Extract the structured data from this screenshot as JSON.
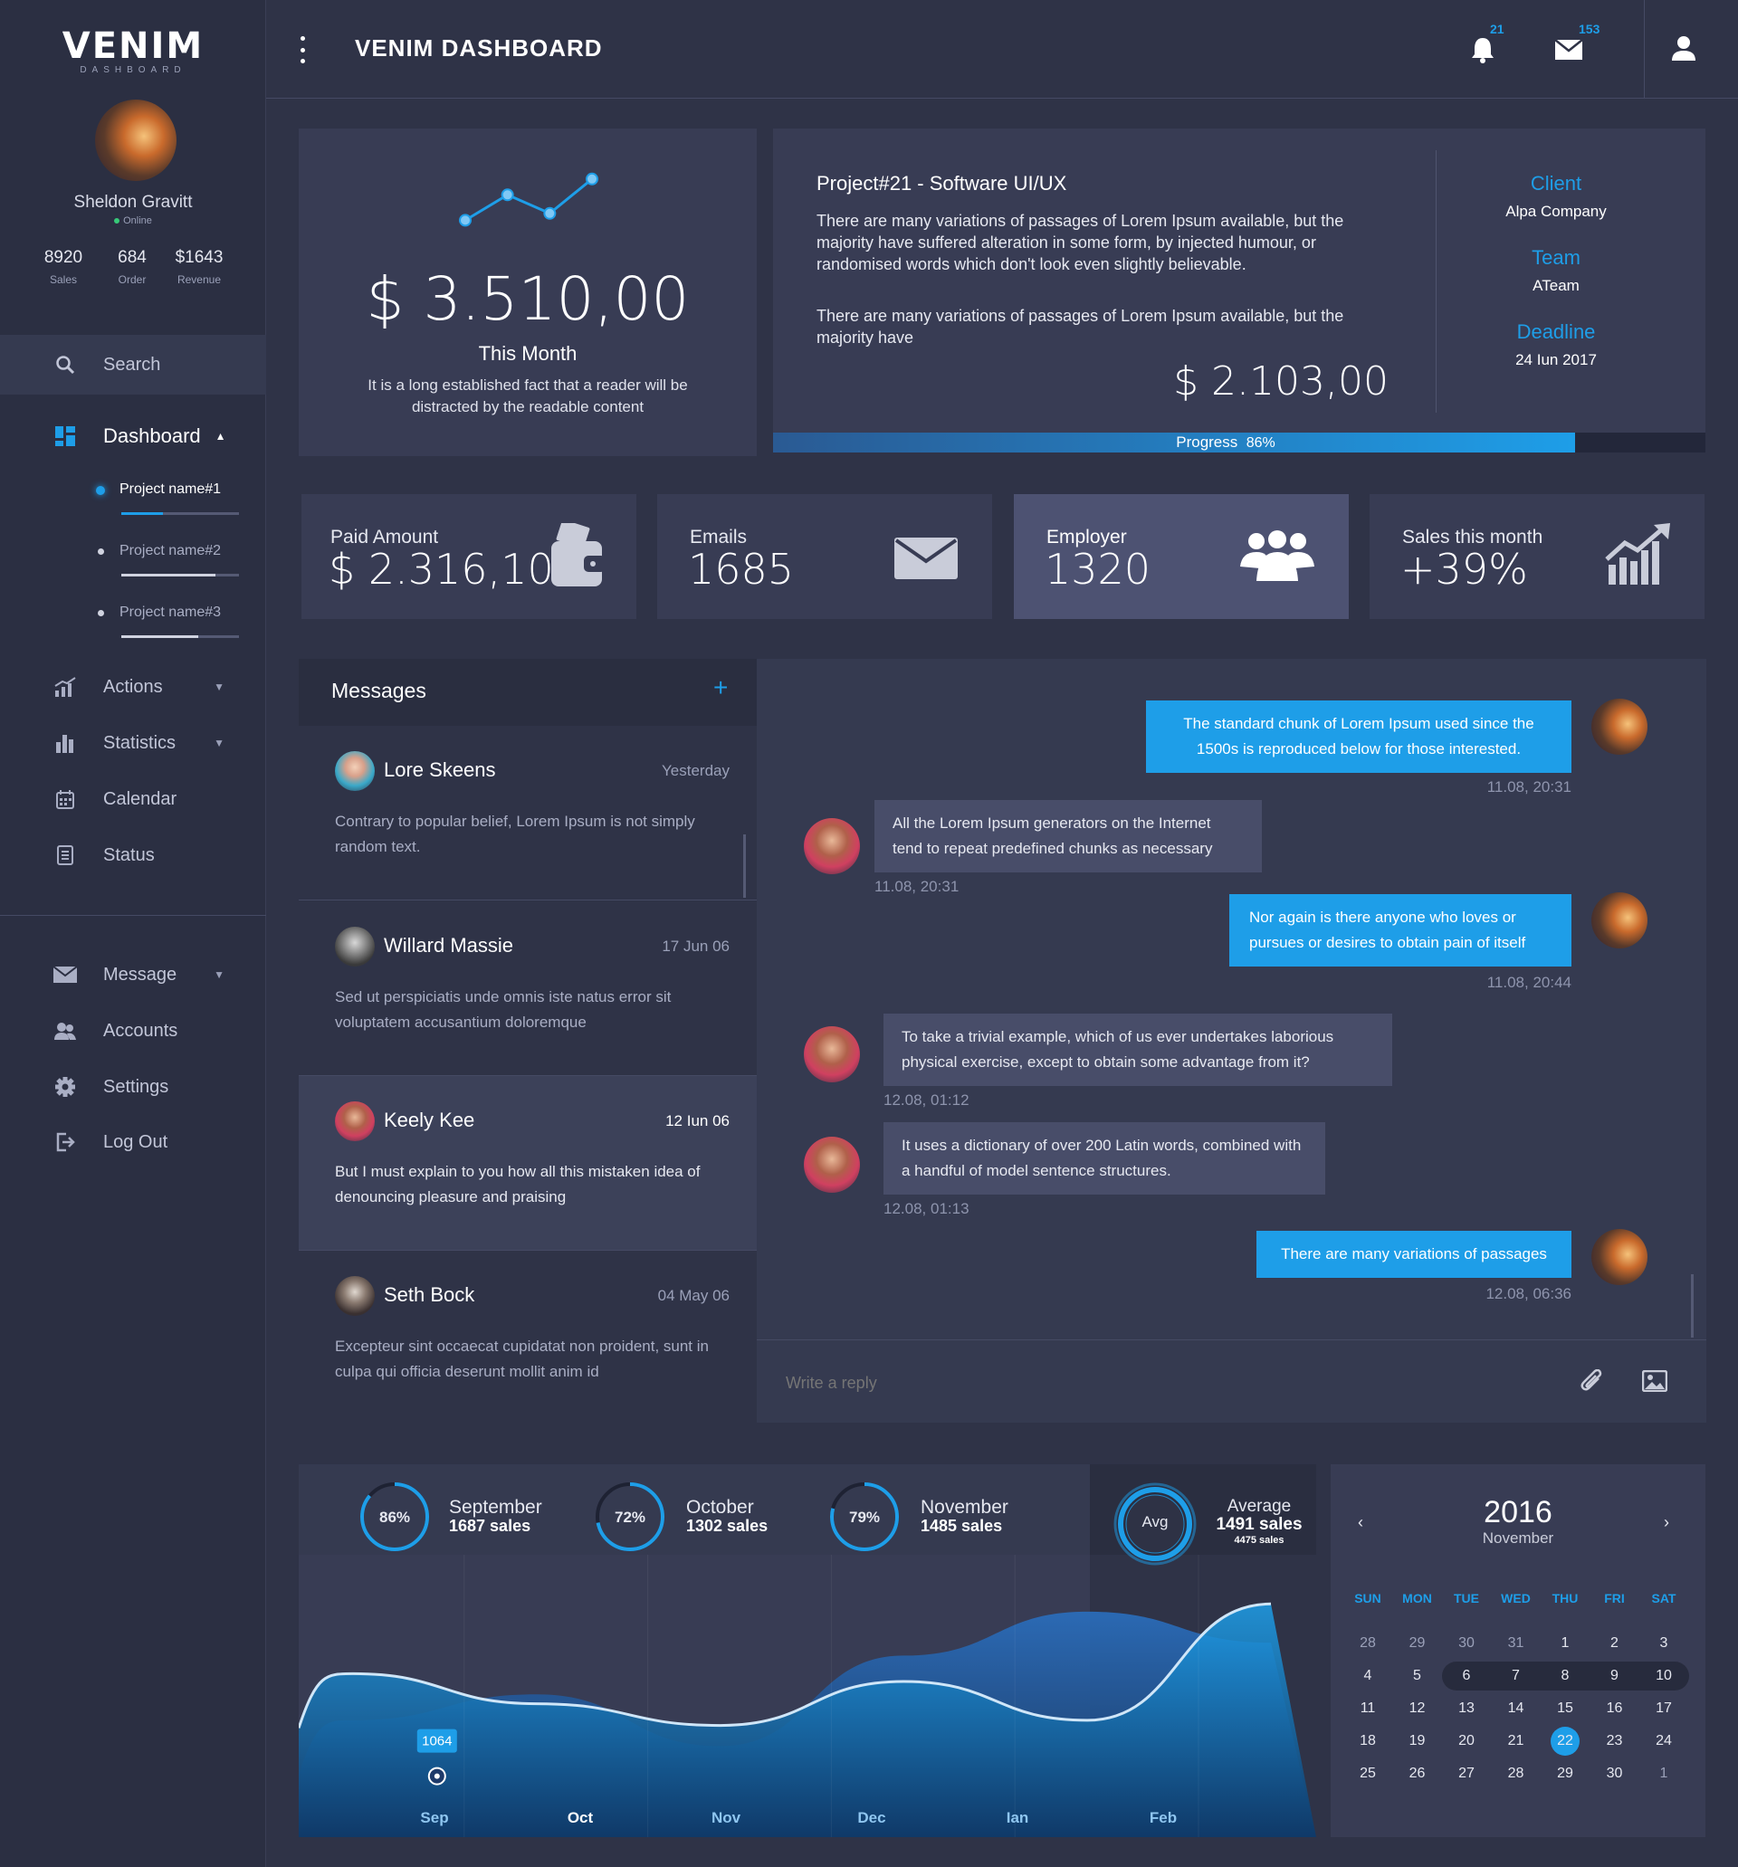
{
  "brand": {
    "name": "VENIM",
    "sub": "DASHBOARD"
  },
  "topbar": {
    "title": "VENIM DASHBOARD",
    "notifications": "21",
    "messages": "153"
  },
  "user": {
    "name": "Sheldon Gravitt",
    "status": "Online",
    "stats": [
      {
        "value": "8920",
        "label": "Sales"
      },
      {
        "value": "684",
        "label": "Order"
      },
      {
        "value": "$1643",
        "label": "Revenue"
      }
    ]
  },
  "sidebar": {
    "search": "Search",
    "dashboard": "Dashboard",
    "projects": [
      "Project name#1",
      "Project name#2",
      "Project name#3"
    ],
    "items1": [
      "Actions",
      "Statistics",
      "Calendar",
      "Status"
    ],
    "items2": [
      "Message",
      "Accounts",
      "Settings",
      "Log Out"
    ]
  },
  "summary": {
    "amount": "$ 3.510,00",
    "period": "This Month",
    "desc": "It is a long established fact that a reader will be distracted by the readable content",
    "trend": [
      0.35,
      0.72,
      0.45,
      0.95
    ]
  },
  "project": {
    "title": "Project#21 - Software UI/UX",
    "p1": "There are many variations of passages of Lorem Ipsum available, but the majority have suffered alteration in some form, by injected humour, or randomised words which don't look even slightly believable.",
    "p2": "There are many variations of passages of Lorem Ipsum available, but the majority have",
    "amount": "$ 2.103,00",
    "client_label": "Client",
    "client": "Alpa Company",
    "team_label": "Team",
    "team": "ATeam",
    "deadline_label": "Deadline",
    "deadline": "24 Iun 2017",
    "progress_label": "Progress",
    "progress_text": "86%",
    "progress": 0.86
  },
  "tiles": [
    {
      "label": "Paid Amount",
      "value": "$ 2.316,10",
      "icon": "wallet-icon"
    },
    {
      "label": "Emails",
      "value": "1685",
      "icon": "envelope-icon"
    },
    {
      "label": "Employer",
      "value": "1320",
      "icon": "users-icon"
    },
    {
      "label": "Sales this month",
      "value": "+39%",
      "icon": "growth-chart-icon"
    }
  ],
  "messages": {
    "title": "Messages",
    "list": [
      {
        "name": "Lore Skeens",
        "date": "Yesterday",
        "text": "Contrary to popular belief, Lorem Ipsum is not simply random text."
      },
      {
        "name": "Willard Massie",
        "date": "17 Jun 06",
        "text": "Sed ut perspiciatis unde omnis iste natus error sit voluptatem accusantium doloremque"
      },
      {
        "name": "Keely Kee",
        "date": "12 Iun 06",
        "text": "But I must explain to you how all this mistaken idea of denouncing pleasure and praising"
      },
      {
        "name": "Seth Bock",
        "date": "04 May 06",
        "text": "Excepteur sint occaecat cupidatat non proident, sunt in culpa qui officia deserunt mollit anim id"
      }
    ]
  },
  "chat": [
    {
      "text": "The standard chunk of Lorem Ipsum used since the 1500s is reproduced below for those interested.",
      "time": "11.08, 20:31"
    },
    {
      "text": "All the Lorem Ipsum generators on the Internet tend to repeat predefined chunks as necessary",
      "time": "11.08, 20:31"
    },
    {
      "text": "Nor again is there anyone who loves or pursues or desires to obtain pain of itself",
      "time": "11.08, 20:44"
    },
    {
      "text": "To take a trivial example, which of us ever undertakes laborious physical exercise, except to obtain some advantage from it?",
      "time": "12.08, 01:12"
    },
    {
      "text": "It uses a dictionary of over 200 Latin words, combined with a handful of model sentence structures.",
      "time": "12.08, 01:13"
    },
    {
      "text": "There are many variations of passages",
      "time": "12.08, 06:36"
    }
  ],
  "reply_placeholder": "Write a reply",
  "monthly": [
    {
      "pct": "86%",
      "value": 0.86,
      "month": "September",
      "sales": "1687 sales"
    },
    {
      "pct": "72%",
      "value": 0.72,
      "month": "October",
      "sales": "1302 sales"
    },
    {
      "pct": "79%",
      "value": 0.79,
      "month": "November",
      "sales": "1485 sales"
    }
  ],
  "average": {
    "badge": "Avg",
    "label": "Average",
    "value": "1491 sales",
    "total": "4475 sales"
  },
  "chart_data": {
    "type": "area",
    "categories": [
      "Sep",
      "Oct",
      "Nov",
      "Dec",
      "Ian",
      "Feb"
    ],
    "highlight": {
      "x": "Oct",
      "value": 1064
    },
    "series": [
      {
        "values": [
          1180,
          1064,
          980,
          1150,
          1000,
          1450
        ]
      },
      {
        "values": [
          1000,
          1100,
          900,
          1250,
          1420,
          1300
        ]
      }
    ]
  },
  "calendar": {
    "year": "2016",
    "month": "November",
    "days": [
      "SUN",
      "MON",
      "TUE",
      "WED",
      "THU",
      "FRI",
      "SAT"
    ],
    "weeks": [
      [
        "28",
        "29",
        "30",
        "31",
        "1",
        "2",
        "3"
      ],
      [
        "4",
        "5",
        "6",
        "7",
        "8",
        "9",
        "10"
      ],
      [
        "11",
        "12",
        "13",
        "14",
        "15",
        "16",
        "17"
      ],
      [
        "18",
        "19",
        "20",
        "21",
        "22",
        "23",
        "24"
      ],
      [
        "25",
        "26",
        "27",
        "28",
        "29",
        "30",
        "1"
      ]
    ],
    "today": "22"
  },
  "colors": {
    "accent": "#1e9ee8",
    "panel": "#383c54",
    "bg": "#2f3347"
  }
}
